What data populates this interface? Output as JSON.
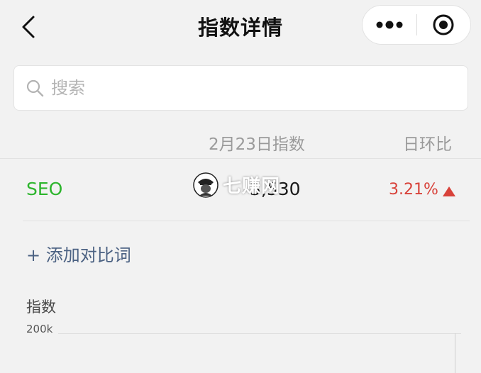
{
  "nav": {
    "title": "指数详情",
    "back_icon": "chevron-left-icon",
    "more_icon": "more-dots-icon",
    "close_icon": "target-circle-icon"
  },
  "search": {
    "placeholder": "搜索",
    "value": ""
  },
  "table": {
    "headers": {
      "date_index": "2月23日指数",
      "day_ratio": "日环比"
    },
    "rows": [
      {
        "term": "SEO",
        "value": "3,530",
        "change": "3.21%",
        "trend": "up"
      }
    ]
  },
  "add_compare": "+ 添加对比词",
  "chart": {
    "label": "指数",
    "tick": "200k"
  },
  "watermark": {
    "text": "七赚网"
  },
  "colors": {
    "term": "#2db52d",
    "up": "#d8423a",
    "link": "#4c6283",
    "background": "#f2f2f2"
  }
}
